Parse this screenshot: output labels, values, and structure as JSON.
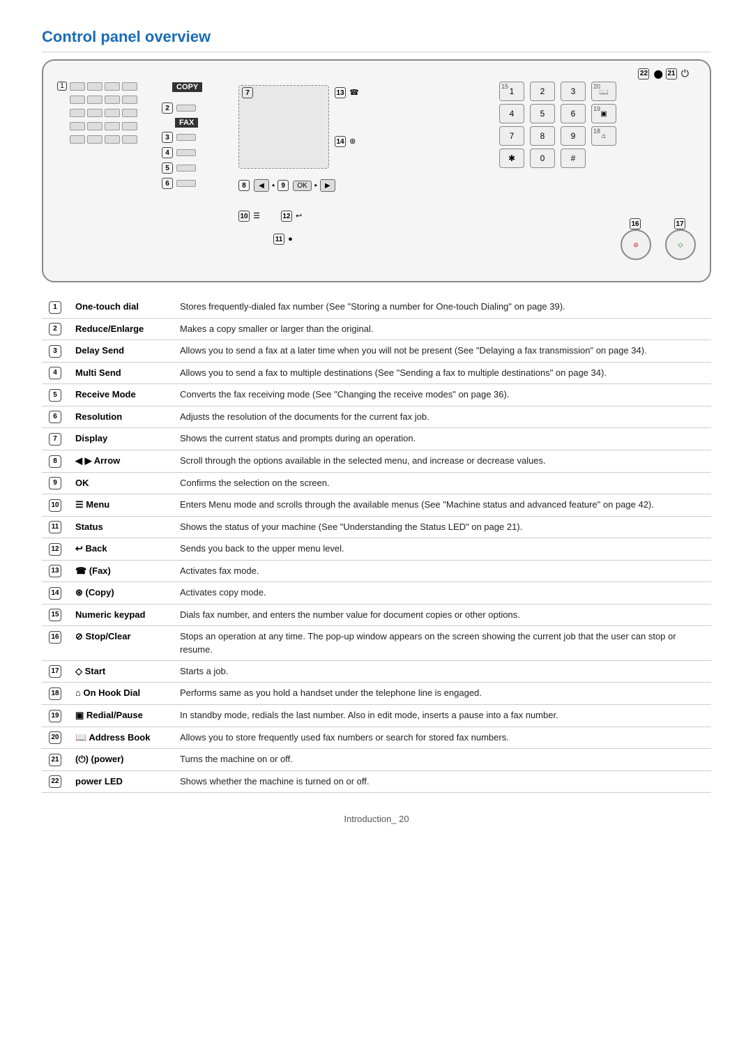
{
  "page": {
    "title": "Control panel overview",
    "footer": "Introduction_ 20"
  },
  "panel": {
    "copy_label": "COPY",
    "fax_label": "FAX",
    "power_label": "⏻",
    "num22": "22",
    "num21": "21"
  },
  "items": [
    {
      "num": "1",
      "name": "One-touch dial",
      "desc": "Stores frequently-dialed fax number (See \"Storing a number for One-touch Dialing\" on page 39)."
    },
    {
      "num": "2",
      "name": "Reduce/Enlarge",
      "desc": "Makes a copy smaller or larger than the original."
    },
    {
      "num": "3",
      "name": "Delay Send",
      "desc": "Allows you to send a fax at a later time when you will not be present (See \"Delaying a fax transmission\" on page 34)."
    },
    {
      "num": "4",
      "name": "Multi Send",
      "desc": "Allows you to send a fax to multiple destinations (See \"Sending a fax to multiple destinations\" on page 34)."
    },
    {
      "num": "5",
      "name": "Receive Mode",
      "desc": "Converts the fax receiving mode (See \"Changing the receive modes\" on page 36)."
    },
    {
      "num": "6",
      "name": "Resolution",
      "desc": "Adjusts the resolution of the documents for the current fax job."
    },
    {
      "num": "7",
      "name": "Display",
      "desc": "Shows the current status and prompts during an operation."
    },
    {
      "num": "8",
      "name": "◀ ▶ Arrow",
      "desc": "Scroll through the options available in the selected menu, and increase or decrease values."
    },
    {
      "num": "9",
      "name": "OK",
      "desc": "Confirms the selection on the screen."
    },
    {
      "num": "10",
      "name": "☰ Menu",
      "desc": "Enters Menu mode and scrolls through the available menus (See \"Machine status and advanced feature\" on page 42)."
    },
    {
      "num": "11",
      "name": "Status",
      "desc": "Shows the status of your machine (See \"Understanding the Status LED\" on page 21)."
    },
    {
      "num": "12",
      "name": "↩ Back",
      "desc": "Sends you back to the upper menu level."
    },
    {
      "num": "13",
      "name": "☎ (Fax)",
      "desc": "Activates fax mode."
    },
    {
      "num": "14",
      "name": "⊛ (Copy)",
      "desc": "Activates copy mode."
    },
    {
      "num": "15",
      "name": "Numeric keypad",
      "desc": "Dials fax number, and enters the number value for document copies or other options."
    },
    {
      "num": "16",
      "name": "⊘ Stop/Clear",
      "desc": "Stops an operation at any time. The pop-up window appears on the screen showing the current job that the user can stop or resume."
    },
    {
      "num": "17",
      "name": "◇ Start",
      "desc": "Starts a job."
    },
    {
      "num": "18",
      "name": "⌂ On Hook Dial",
      "desc": "Performs same as you hold a handset under the telephone line is engaged."
    },
    {
      "num": "19",
      "name": "▣ Redial/Pause",
      "desc": "In standby mode, redials the last number. Also in edit mode, inserts a pause into a fax number."
    },
    {
      "num": "20",
      "name": "📖 Address Book",
      "desc": "Allows you to store frequently used fax numbers or search for stored fax numbers."
    },
    {
      "num": "21",
      "name": "(⏻) (power)",
      "desc": "Turns the machine on or off."
    },
    {
      "num": "22",
      "name": "power LED",
      "desc": "Shows whether the machine is turned on or off."
    }
  ]
}
